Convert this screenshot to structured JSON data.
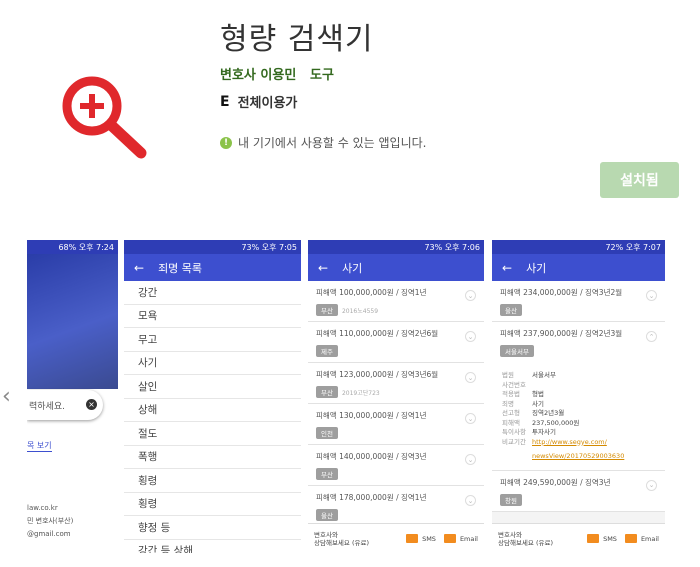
{
  "app": {
    "title": "형량 검색기",
    "developer": "변호사 이용민",
    "category": "도구",
    "rating_badge": "E",
    "rating_label": "전체이용가",
    "notice": "내 기기에서 사용할 수 있는 앱입니다.",
    "install_label": "설치됨"
  },
  "colors": {
    "icon_red": "#e0282c",
    "accent_green": "#33691e",
    "install_bg": "#b8d9b0",
    "app_bar": "#3d4fcf"
  },
  "screens": {
    "s1": {
      "status": "68% 오후 7:24",
      "search_text": "력하세요.",
      "link": "목 보기",
      "footer_lines": [
        "law.co.kr",
        "민 변호사(부산)",
        "@gmail.com"
      ]
    },
    "s2": {
      "status": "73% 오후 7:05",
      "title": "죄명 목록",
      "items": [
        "강간",
        "모욕",
        "무고",
        "사기",
        "살인",
        "상해",
        "절도",
        "폭행",
        "횡령",
        "횡령",
        "향정 등",
        "강간 등 상해"
      ]
    },
    "s3": {
      "status": "73% 오후 7:06",
      "title": "사기",
      "cases": [
        {
          "text": "피해액 100,000,000원 / 징역1년",
          "tag": "부산",
          "sub": "2016노4559"
        },
        {
          "text": "피해액 110,000,000원 / 징역2년6월",
          "tag": "제주",
          "sub": ""
        },
        {
          "text": "피해액 123,000,000원 / 징역3년6월",
          "tag": "부산",
          "sub": "2019고단723"
        },
        {
          "text": "피해액 130,000,000원 / 징역1년",
          "tag": "인천",
          "sub": ""
        },
        {
          "text": "피해액 140,000,000원 / 징역3년",
          "tag": "부산",
          "sub": ""
        },
        {
          "text": "피해액 178,000,000원 / 징역1년",
          "tag": "울산",
          "sub": ""
        }
      ],
      "bottom": {
        "consult": "변호사와\n상담해보세요 (유료)",
        "sms": "SMS",
        "email": "Email"
      }
    },
    "s4": {
      "status": "72% 오후 7:07",
      "title": "사기",
      "cases_top": [
        {
          "text": "피해액 234,000,000원 / 징역3년2월",
          "tag": "울산"
        },
        {
          "text": "피해액 237,900,000원 / 징역2년3월",
          "tag": "서울서부"
        }
      ],
      "detail": [
        {
          "k": "법원",
          "v": "서울서부"
        },
        {
          "k": "사건번호",
          "v": ""
        },
        {
          "k": "적용법",
          "v": "형법"
        },
        {
          "k": "죄명",
          "v": "사기"
        },
        {
          "k": "선고형",
          "v": "징역2년3월"
        },
        {
          "k": "피해액",
          "v": "237,500,000원"
        },
        {
          "k": "특이사항",
          "v": "투자사기"
        },
        {
          "k": "비교기간",
          "v": "http://www.segye.com/"
        }
      ],
      "detail_link2": "newsView/20170529003630",
      "cases_bottom": [
        {
          "text": "피해액 249,590,000원 / 징역3년",
          "tag": "창원"
        }
      ],
      "bottom": {
        "consult": "변호사와\n상담해보세요 (유료)",
        "sms": "SMS",
        "email": "Email"
      }
    }
  }
}
